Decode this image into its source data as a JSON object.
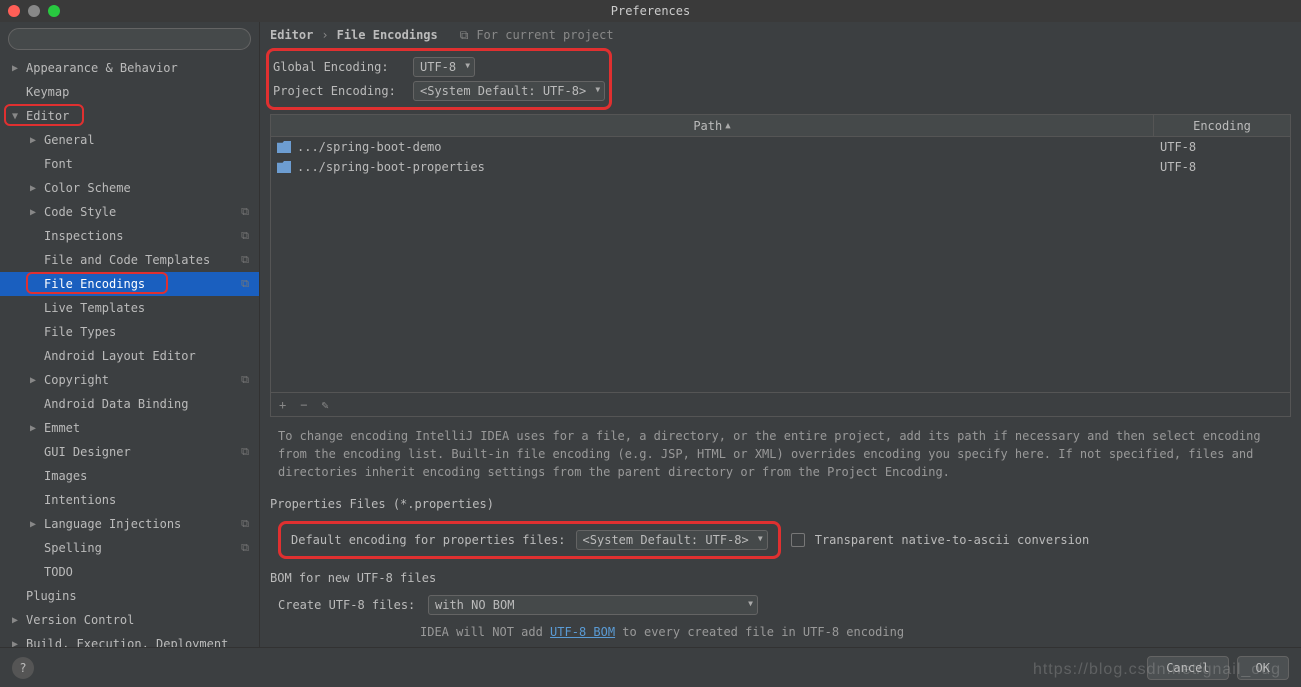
{
  "window": {
    "title": "Preferences"
  },
  "sidebar": {
    "search_placeholder": "",
    "items": [
      {
        "label": "Appearance & Behavior",
        "level": 0,
        "arrow": "right"
      },
      {
        "label": "Keymap",
        "level": 0,
        "arrow": "none"
      },
      {
        "label": "Editor",
        "level": 0,
        "arrow": "down",
        "highlight": true
      },
      {
        "label": "General",
        "level": 1,
        "arrow": "right"
      },
      {
        "label": "Font",
        "level": 1,
        "arrow": "none"
      },
      {
        "label": "Color Scheme",
        "level": 1,
        "arrow": "right"
      },
      {
        "label": "Code Style",
        "level": 1,
        "arrow": "right",
        "copy": true
      },
      {
        "label": "Inspections",
        "level": 1,
        "arrow": "none",
        "copy": true
      },
      {
        "label": "File and Code Templates",
        "level": 1,
        "arrow": "none",
        "copy": true
      },
      {
        "label": "File Encodings",
        "level": 1,
        "arrow": "none",
        "copy": true,
        "selected": true,
        "highlight": true
      },
      {
        "label": "Live Templates",
        "level": 1,
        "arrow": "none"
      },
      {
        "label": "File Types",
        "level": 1,
        "arrow": "none"
      },
      {
        "label": "Android Layout Editor",
        "level": 1,
        "arrow": "none"
      },
      {
        "label": "Copyright",
        "level": 1,
        "arrow": "right",
        "copy": true
      },
      {
        "label": "Android Data Binding",
        "level": 1,
        "arrow": "none"
      },
      {
        "label": "Emmet",
        "level": 1,
        "arrow": "right"
      },
      {
        "label": "GUI Designer",
        "level": 1,
        "arrow": "none",
        "copy": true
      },
      {
        "label": "Images",
        "level": 1,
        "arrow": "none"
      },
      {
        "label": "Intentions",
        "level": 1,
        "arrow": "none"
      },
      {
        "label": "Language Injections",
        "level": 1,
        "arrow": "right",
        "copy": true
      },
      {
        "label": "Spelling",
        "level": 1,
        "arrow": "none",
        "copy": true
      },
      {
        "label": "TODO",
        "level": 1,
        "arrow": "none"
      },
      {
        "label": "Plugins",
        "level": 0,
        "arrow": "none"
      },
      {
        "label": "Version Control",
        "level": 0,
        "arrow": "right"
      },
      {
        "label": "Build, Execution, Deployment",
        "level": 0,
        "arrow": "right"
      }
    ]
  },
  "breadcrumb": {
    "parent": "Editor",
    "child": "File Encodings",
    "scope_label": "For current project"
  },
  "encodings": {
    "global_label": "Global Encoding:",
    "global_value": "UTF-8",
    "project_label": "Project Encoding:",
    "project_value": "<System Default: UTF-8>"
  },
  "table": {
    "headers": {
      "path": "Path",
      "encoding": "Encoding"
    },
    "rows": [
      {
        "path": ".../spring-boot-demo",
        "encoding": "UTF-8"
      },
      {
        "path": ".../spring-boot-properties",
        "encoding": "UTF-8"
      }
    ],
    "toolbar": {
      "add": "+",
      "remove": "−",
      "edit": "✎"
    }
  },
  "description": "To change encoding IntelliJ IDEA uses for a file, a directory, or the entire project, add its path if necessary and then select encoding from the encoding list. Built-in file encoding (e.g. JSP, HTML or XML) overrides encoding you specify here. If not specified, files and directories inherit encoding settings from the parent directory or from the Project Encoding.",
  "properties": {
    "section": "Properties Files (*.properties)",
    "default_label": "Default encoding for properties files:",
    "default_value": "<System Default: UTF-8>",
    "transparent_label": "Transparent native-to-ascii conversion"
  },
  "bom": {
    "section": "BOM for new UTF-8 files",
    "create_label": "Create UTF-8 files:",
    "create_value": "with NO BOM",
    "hint_pre": "IDEA will NOT add ",
    "hint_link": "UTF-8 BOM",
    "hint_post": " to every created file in UTF-8 encoding"
  },
  "footer": {
    "cancel": "Cancel",
    "ok": "OK"
  },
  "watermark": "https://blog.csdn.net/gnail_oug"
}
